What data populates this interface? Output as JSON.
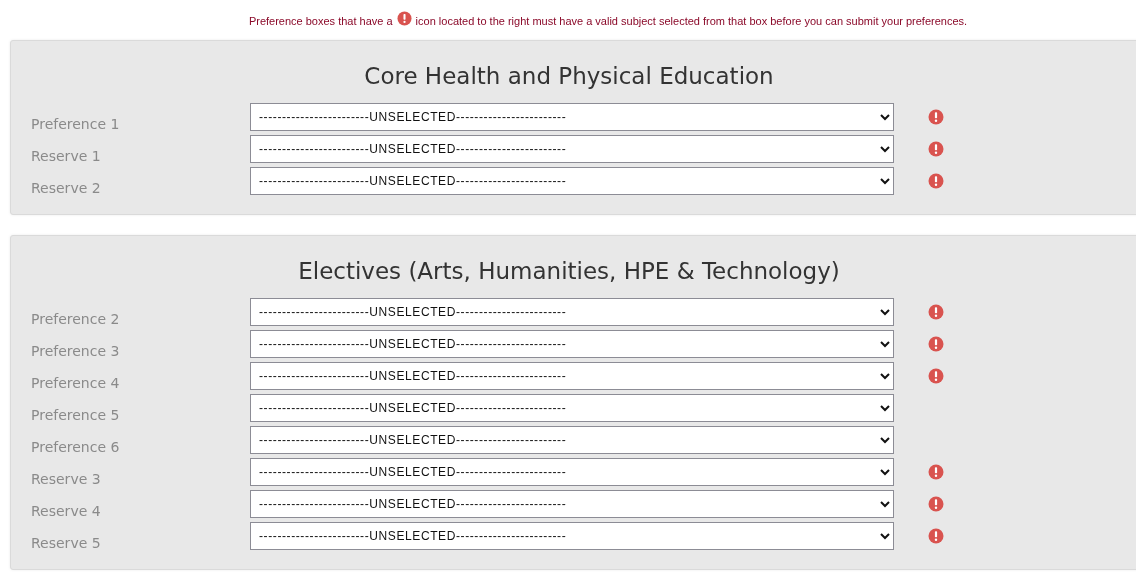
{
  "notice": {
    "before": "Preference boxes that have a",
    "after": "icon located to the right must have a valid subject selected from that box before you can submit your preferences."
  },
  "sections": [
    {
      "title": "Core Health and Physical Education",
      "rows": [
        {
          "label": "Preference 1",
          "value": "------------------------UNSELECTED------------------------",
          "invalid": true
        },
        {
          "label": "Reserve 1",
          "value": "------------------------UNSELECTED------------------------",
          "invalid": true
        },
        {
          "label": "Reserve 2",
          "value": "------------------------UNSELECTED------------------------",
          "invalid": true
        }
      ]
    },
    {
      "title": "Electives (Arts, Humanities, HPE & Technology)",
      "rows": [
        {
          "label": "Preference 2",
          "value": "------------------------UNSELECTED------------------------",
          "invalid": true
        },
        {
          "label": "Preference 3",
          "value": "------------------------UNSELECTED------------------------",
          "invalid": true
        },
        {
          "label": "Preference 4",
          "value": "------------------------UNSELECTED------------------------",
          "invalid": true
        },
        {
          "label": "Preference 5",
          "value": "------------------------UNSELECTED------------------------",
          "invalid": false
        },
        {
          "label": "Preference 6",
          "value": "------------------------UNSELECTED------------------------",
          "invalid": false
        },
        {
          "label": "Reserve 3",
          "value": "------------------------UNSELECTED------------------------",
          "invalid": true
        },
        {
          "label": "Reserve 4",
          "value": "------------------------UNSELECTED------------------------",
          "invalid": true
        },
        {
          "label": "Reserve 5",
          "value": "------------------------UNSELECTED------------------------",
          "invalid": true
        }
      ]
    }
  ]
}
